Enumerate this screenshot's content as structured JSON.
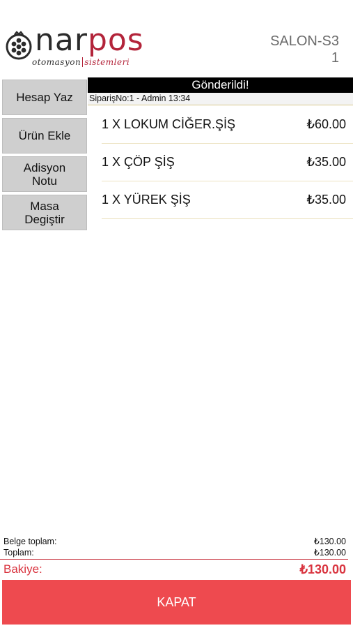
{
  "brand": {
    "word_dark": "nar",
    "word_accent": "pos",
    "sub_left": "otomasyon",
    "sub_right": "sistemleri",
    "accent_color": "#b3243a"
  },
  "table": {
    "name": "SALON-S3",
    "number": "1"
  },
  "side_buttons": {
    "hesap_yaz": "Hesap Yaz",
    "urun_ekle": "Ürün Ekle",
    "adisyon_notu_1": "Adisyon",
    "adisyon_notu_2": "Notu",
    "masa_degistir_1": "Masa",
    "masa_degistir_2": "Degiştir"
  },
  "order": {
    "status": "Gönderildi!",
    "meta": "SiparişNo:1 - Admin 13:34",
    "items": [
      {
        "name": "1 X LOKUM CİĞER.ŞİŞ",
        "price": "₺60.00"
      },
      {
        "name": "1 X ÇÖP ŞİŞ",
        "price": "₺35.00"
      },
      {
        "name": "1 X YÜREK ŞİŞ",
        "price": "₺35.00"
      }
    ]
  },
  "totals": {
    "belge_label": "Belge toplam:",
    "belge_value": "₺130.00",
    "toplam_label": "Toplam:",
    "toplam_value": "₺130.00",
    "bakiye_label": "Bakiye:",
    "bakiye_value": "₺130.00"
  },
  "actions": {
    "kapat": "KAPAT",
    "kapat_color": "#ee4a4f"
  }
}
